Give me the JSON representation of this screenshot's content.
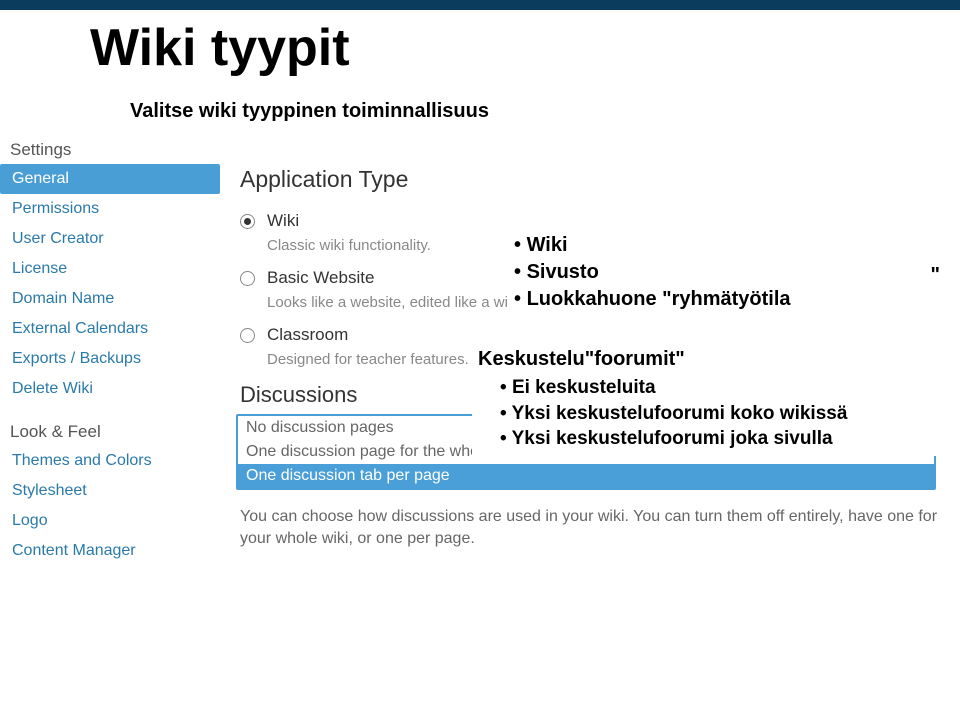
{
  "slide": {
    "title": "Wiki tyypit",
    "subtitle": "Valitse wiki tyyppinen toiminnallisuus"
  },
  "sidebar": {
    "groups": [
      {
        "label": "Settings",
        "items": [
          {
            "label": "General",
            "active": true
          },
          {
            "label": "Permissions"
          },
          {
            "label": "User Creator"
          },
          {
            "label": "License"
          },
          {
            "label": "Domain Name"
          },
          {
            "label": "External Calendars"
          },
          {
            "label": "Exports / Backups"
          },
          {
            "label": "Delete Wiki"
          }
        ]
      },
      {
        "label": "Look & Feel",
        "items": [
          {
            "label": "Themes and Colors"
          },
          {
            "label": "Stylesheet"
          },
          {
            "label": "Logo"
          },
          {
            "label": "Content Manager"
          }
        ]
      }
    ]
  },
  "main": {
    "section_title": "Application Type",
    "options": [
      {
        "label": "Wiki",
        "desc": "Classic wiki functionality.",
        "checked": true
      },
      {
        "label": "Basic Website",
        "desc": "Looks like a website, edited like a wiki."
      },
      {
        "label": "Classroom",
        "desc": "Designed for teacher features."
      }
    ],
    "discussions": {
      "header": "Discussions",
      "options": [
        {
          "label": "No discussion pages"
        },
        {
          "label": "One discussion page for the whole wiki"
        },
        {
          "label": "One discussion tab per page",
          "selected": true
        }
      ],
      "help": "You can choose how discussions are used in your wiki. You can turn them off entirely, have one for your whole wiki, or one per page."
    }
  },
  "overlay1": {
    "b1": "Wiki",
    "b2": "Sivusto",
    "b3": "Luokkahuone \"ryhmätyötila"
  },
  "overlay2": {
    "heading": "Keskustelu\"foorumit\"",
    "b1": "Ei keskusteluita",
    "b2": "Yksi keskustelufoorumi koko wikissä",
    "b3": "Yksi keskustelufoorumi joka sivulla"
  }
}
